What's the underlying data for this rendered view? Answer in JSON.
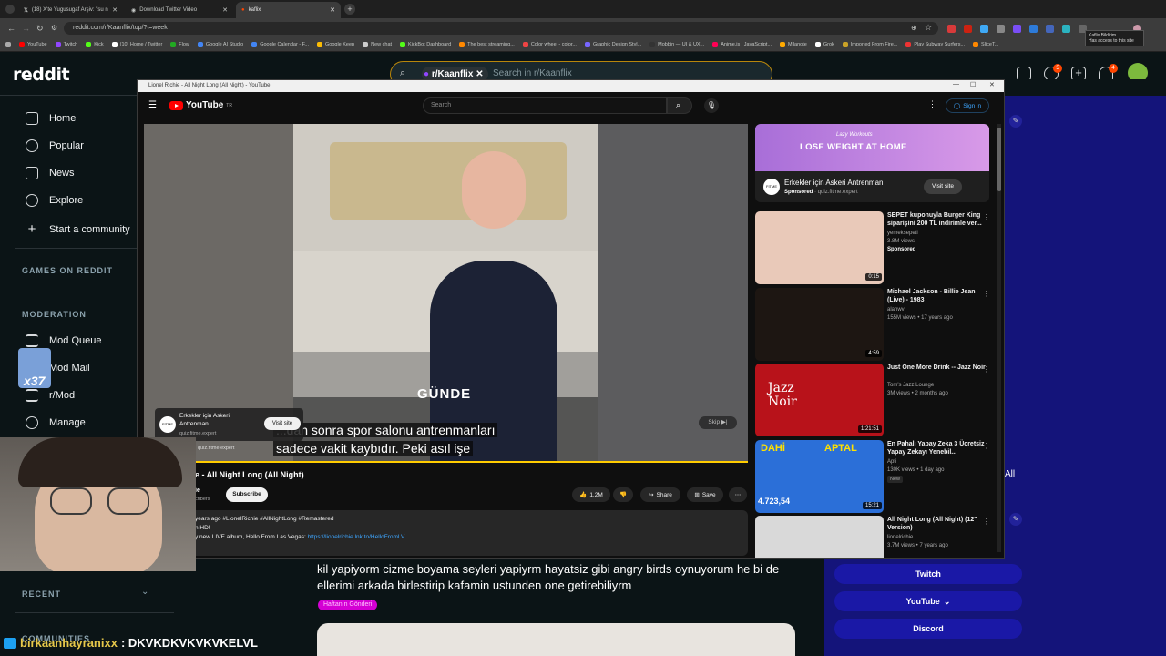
{
  "browser": {
    "tabs": [
      {
        "label": "(18) X'te Yugusugaf Arşiv: \"su n",
        "active": false
      },
      {
        "label": "Download Twitter Video",
        "active": false
      },
      {
        "label": "kaflix",
        "active": true
      }
    ],
    "new_tab_label": "+",
    "url": "reddit.com/r/Kaanflix/top/?t=week",
    "bookmarks": [
      "YouTube",
      "Twitch",
      "Kick",
      "(10) Home / Twitter",
      "Flow",
      "Google AI Studio",
      "Google Calendar - F...",
      "Google Keep",
      "New chat",
      "KickBot Dashboard",
      "The best streaming...",
      "Color wheel - color...",
      "Graphic Design Styl...",
      "Mobbin — UI & UX...",
      "Anime.js | JavaScript...",
      "Milanote",
      "Grok",
      "Imported From Fire...",
      "Play Subway Surfers...",
      "SliceT..."
    ],
    "tooltip": {
      "line1": "Kaflix Bildirim",
      "line2": "Has access to this site"
    }
  },
  "reddit": {
    "logo": "reddit",
    "search_chip": "r/Kaanflix",
    "search_placeholder": "Search in r/Kaanflix",
    "header_badges": {
      "chat": "5",
      "notifications": "4"
    },
    "nav": {
      "home": "Home",
      "popular": "Popular",
      "news": "News",
      "explore": "Explore",
      "start_community": "Start a community",
      "games_section": "GAMES ON REDDIT",
      "moderation_section": "MODERATION",
      "mod_queue": "Mod Queue",
      "mod_mail": "Mod Mail",
      "rmod": "r/Mod",
      "manage": "Manage",
      "recent_section": "RECENT",
      "communities_section": "COMMUNITIES"
    },
    "post": {
      "text": "kil yapiyorm cizme boyama seyleri yapiyrm hayatsiz gibi angry birds oynuyorum he bi de ellerimi arkada birlestirip kafamin ustunden one getirebiliyrm",
      "flair": "Haftanın Gönderi"
    },
    "right_buttons": {
      "all": "All",
      "twitch": "Twitch",
      "youtube": "YouTube",
      "discord": "Discord"
    }
  },
  "youtube": {
    "window_title": "Lionel Richie - All Night Long (All Night) - YouTube",
    "logo": "YouTube",
    "logo_sup": "TR",
    "search_placeholder": "Search",
    "sign_in": "Sign in",
    "video": {
      "overlay_word": "GÜNDE",
      "subtitle_line1": "...dan sonra spor salonu antrenmanları",
      "subtitle_line2": "sadece vakit kaybıdır. Peki asıl işe",
      "ad_name": "Erkekler için Askeri Antrenman",
      "ad_url": "quiz.fitme.expert",
      "ad_visit": "Visit site",
      "ad_url_lower": "quiz.fitme.expert",
      "skip": "Skip"
    },
    "title": "e - All Night Long (All Night)",
    "channel_partial": "ie",
    "subscribers_partial": "cribers",
    "subscribe": "Subscribe",
    "actions": {
      "likes": "1.2M",
      "share": "Share",
      "save": "Save"
    },
    "description": {
      "line1": "years ago  #LionelRichie #AllNightLong #Remastered",
      "line2": "n HD!",
      "line3": "y new LIVE album, Hello From Las Vegas: ",
      "link": "https://lionelrichie.lnk.to/HelloFromLV"
    },
    "sidebar_ad": {
      "banner_small": "Lazy Workouts",
      "banner_text": "LOSE WEIGHT AT HOME",
      "title": "Erkekler için Askeri Antrenman",
      "sponsored": "Sponsored",
      "url": "quiz.fitme.expert",
      "visit": "Visit site"
    },
    "recommendations": [
      {
        "title": "SEPET kuponuyla Burger King siparişini 200 TL indirimle ver...",
        "channel": "yemeksepeti",
        "meta": "3.8M views",
        "badge": "Sponsored",
        "duration": "0:15",
        "thumb_color": "#e9c9b9"
      },
      {
        "title": "Michael Jackson - Billie Jean (Live) - 1983",
        "channel": "alanwv",
        "meta": "155M views • 17 years ago",
        "badge": "",
        "duration": "4:59",
        "thumb_color": "#1d1612"
      },
      {
        "title": "Just One More Drink -- Jazz Noir",
        "channel": "Tom's Jazz Lounge",
        "meta": "3M views • 2 months ago",
        "badge": "",
        "duration": "1:21:51",
        "thumb_color": "#b8121a"
      },
      {
        "title": "En Pahalı Yapay Zeka 3 Ücretsiz Yapay Zekayı Yenebil...",
        "channel": "Apti",
        "meta": "130K views • 1 day ago",
        "badge": "New",
        "duration": "15:21",
        "thumb_color": "#2b6fd8"
      },
      {
        "title": "All Night Long (All Night) (12\" Version)",
        "channel": "lionelrichie",
        "meta": "3.7M views • 7 years ago",
        "badge": "",
        "duration": "",
        "thumb_color": "#d9d9d9"
      }
    ],
    "thumb_texts": {
      "jazz": "Jazz",
      "noir": "Noir",
      "dahi": "DAHİ",
      "aptal": "APTAL",
      "counter": "4.723,54"
    }
  },
  "overlay": {
    "badge_number": "x37",
    "chat_user": "birkaanhayranixx",
    "chat_message": ": DKVKDKVKVKVKELVL"
  },
  "colors": {
    "reddit_bg": "#0b1416",
    "right_panel": "#14147a",
    "accent_orange": "#ff4500",
    "yt_red": "#ff0000",
    "progress": "#ffcc00",
    "flair": "#d400d4"
  }
}
